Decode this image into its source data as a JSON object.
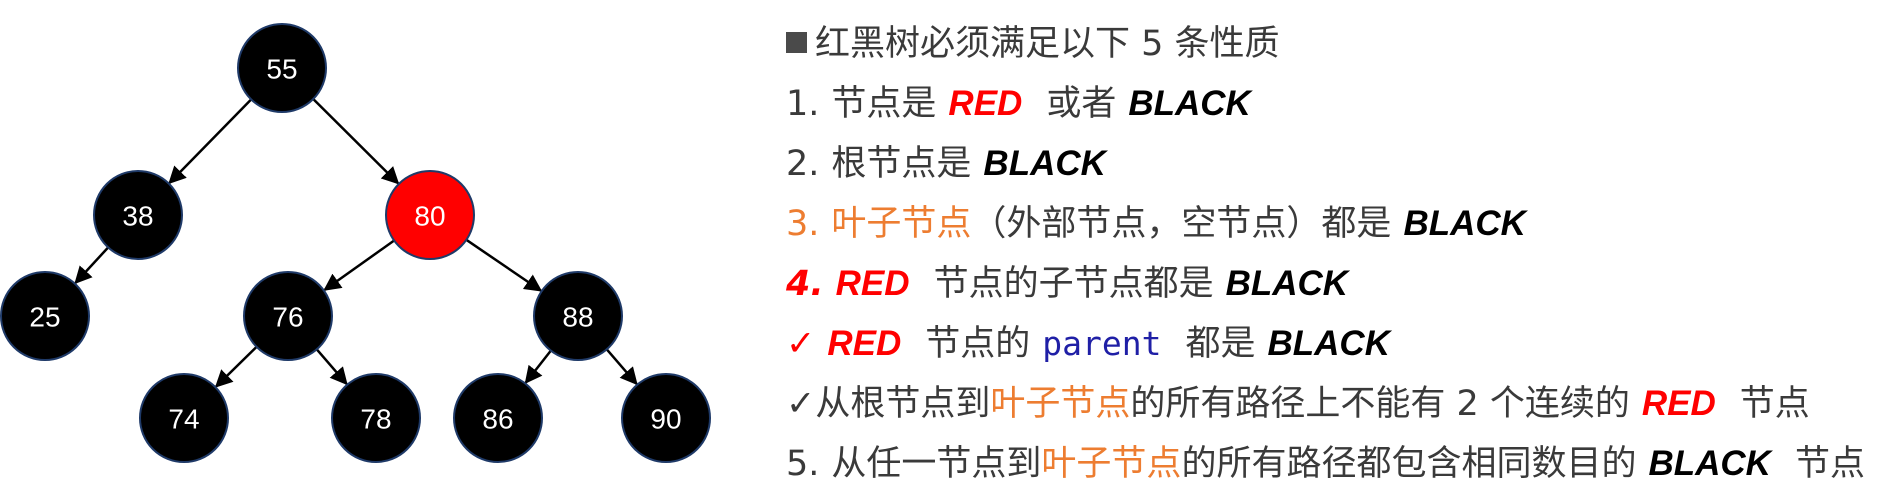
{
  "colors": {
    "red_node": "#ff0000",
    "black_node": "#000000",
    "orange_text": "#ed7d31",
    "red_text": "#ff0000",
    "code_text": "#1f1fa6"
  },
  "tree": {
    "nodes": [
      {
        "id": "n55",
        "label": "55",
        "color": "black"
      },
      {
        "id": "n38",
        "label": "38",
        "color": "black"
      },
      {
        "id": "n80",
        "label": "80",
        "color": "red"
      },
      {
        "id": "n25",
        "label": "25",
        "color": "black"
      },
      {
        "id": "n76",
        "label": "76",
        "color": "black"
      },
      {
        "id": "n88",
        "label": "88",
        "color": "black"
      },
      {
        "id": "n74",
        "label": "74",
        "color": "black"
      },
      {
        "id": "n78",
        "label": "78",
        "color": "black"
      },
      {
        "id": "n86",
        "label": "86",
        "color": "black"
      },
      {
        "id": "n90",
        "label": "90",
        "color": "black"
      }
    ],
    "edges": [
      [
        "n55",
        "n38"
      ],
      [
        "n55",
        "n80"
      ],
      [
        "n38",
        "n25"
      ],
      [
        "n80",
        "n76"
      ],
      [
        "n80",
        "n88"
      ],
      [
        "n76",
        "n74"
      ],
      [
        "n76",
        "n78"
      ],
      [
        "n88",
        "n86"
      ],
      [
        "n88",
        "n90"
      ]
    ]
  },
  "rules": {
    "heading": "红黑树必须满足以下 5 条性质",
    "r1": {
      "num": "1.",
      "a": "节点是",
      "red": "RED",
      "b": "或者",
      "black": "BLACK"
    },
    "r2": {
      "num": "2.",
      "a": "根节点是",
      "black": "BLACK"
    },
    "r3": {
      "num": "3.",
      "orange": "叶子节点",
      "a": "（外部节点，空节点）都是",
      "black": "BLACK"
    },
    "r4": {
      "num": "4.",
      "red": "RED",
      "a": "节点的子节点都是",
      "black": "BLACK"
    },
    "c1": {
      "check": "✓",
      "red": "RED",
      "a": "节点的",
      "code": "parent",
      "b": "都是",
      "black": "BLACK"
    },
    "c2": {
      "check": "✓",
      "a": "从根节点到",
      "orange": "叶子节点",
      "b": "的所有路径上不能有 2 个连续的",
      "red": "RED",
      "c": "节点"
    },
    "r5": {
      "num": "5.",
      "a": "从任一节点到",
      "orange": "叶子节点",
      "b": "的所有路径都包含相同数目的",
      "black": "BLACK",
      "c": "节点"
    }
  }
}
